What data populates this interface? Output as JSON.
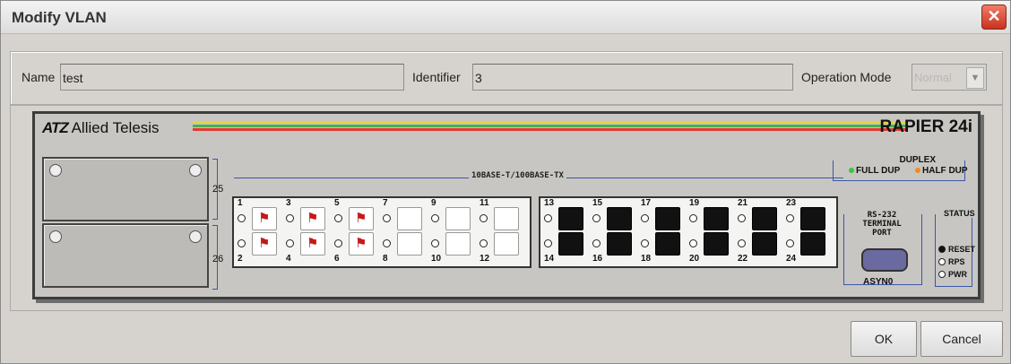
{
  "window": {
    "title": "Modify VLAN",
    "close_glyph": "✕"
  },
  "form": {
    "name_label": "Name",
    "name_value": "test",
    "identifier_label": "Identifier",
    "identifier_value": "3",
    "operation_mode_label": "Operation Mode",
    "operation_mode_value": "Normal"
  },
  "device": {
    "brand": "Allied Telesis",
    "brand_mark": "ATZ",
    "model": "RAPIER 24i",
    "stripe_colors": [
      "#e8d23a",
      "#3fb34f",
      "#e23a2a"
    ],
    "slot_top": "25",
    "slot_bottom": "26",
    "port_header": "10BASE-T/100BASE-TX",
    "ports": [
      {
        "num": "1",
        "flag": true
      },
      {
        "num": "2",
        "flag": true
      },
      {
        "num": "3",
        "flag": true
      },
      {
        "num": "4",
        "flag": true
      },
      {
        "num": "5",
        "flag": true
      },
      {
        "num": "6",
        "flag": true
      },
      {
        "num": "7",
        "flag": false
      },
      {
        "num": "8",
        "flag": false
      },
      {
        "num": "9",
        "flag": false
      },
      {
        "num": "10",
        "flag": false
      },
      {
        "num": "11",
        "flag": false
      },
      {
        "num": "12",
        "flag": false
      },
      {
        "num": "13",
        "flag": false
      },
      {
        "num": "14",
        "flag": false
      },
      {
        "num": "15",
        "flag": false
      },
      {
        "num": "16",
        "flag": false
      },
      {
        "num": "17",
        "flag": false
      },
      {
        "num": "18",
        "flag": false
      },
      {
        "num": "19",
        "flag": false
      },
      {
        "num": "20",
        "flag": false
      },
      {
        "num": "21",
        "flag": false
      },
      {
        "num": "22",
        "flag": false
      },
      {
        "num": "23",
        "flag": false
      },
      {
        "num": "24",
        "flag": false
      }
    ],
    "duplex_label": "DUPLEX",
    "full_dup": "FULL DUP",
    "half_dup": "HALF DUP",
    "full_dup_color": "#3cc53c",
    "half_dup_color": "#f08a24",
    "rs232_label": "RS-232\nTERMINAL\nPORT",
    "asyn_label": "ASYN0",
    "status_label": "STATUS",
    "status_items": [
      "RESET",
      "RPS",
      "PWR"
    ]
  },
  "buttons": {
    "ok": "OK",
    "cancel": "Cancel"
  }
}
